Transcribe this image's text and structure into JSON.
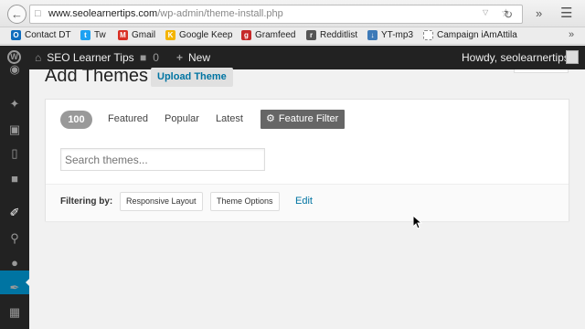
{
  "browser": {
    "url_host": "www.seolearnertips.com",
    "url_path": "/wp-admin/theme-install.php",
    "back_icon": "arrow-left-icon",
    "reload_icon": "reload-icon",
    "menu_icon": "hamburger-icon"
  },
  "bookmarks": [
    {
      "label": "Contact DT",
      "icon": "outlook-icon",
      "color": "#0f6cbd"
    },
    {
      "label": "Tw",
      "icon": "twitter-icon",
      "color": "#1da1f2"
    },
    {
      "label": "Gmail",
      "icon": "gmail-icon",
      "color": "#d93025"
    },
    {
      "label": "Google Keep",
      "icon": "keep-icon",
      "color": "#f4b400"
    },
    {
      "label": "Gramfeed",
      "icon": "gramfeed-icon",
      "color": "#c62828"
    },
    {
      "label": "Redditlist",
      "icon": "reddit-icon",
      "color": "#555555"
    },
    {
      "label": "YT-mp3",
      "icon": "download-icon",
      "color": "#3d7ab8"
    },
    {
      "label": "Campaign iAmAttila",
      "icon": "page-icon",
      "color": "#888888"
    }
  ],
  "adminbar": {
    "site_name": "SEO Learner Tips",
    "comments_count": "0",
    "new_label": "New",
    "howdy": "Howdy, seolearnertips"
  },
  "page": {
    "title": "Add Themes",
    "upload_label": "Upload Theme"
  },
  "filters": {
    "count": "100",
    "tabs": [
      "Featured",
      "Popular",
      "Latest"
    ],
    "feature_filter_label": "Feature Filter",
    "search_placeholder": "Search themes...",
    "filtering_by_label": "Filtering by:",
    "tags": [
      "Responsive Layout",
      "Theme Options"
    ],
    "edit_label": "Edit"
  },
  "colors": {
    "admin_dark": "#222222",
    "accent_blue": "#0074a2"
  }
}
